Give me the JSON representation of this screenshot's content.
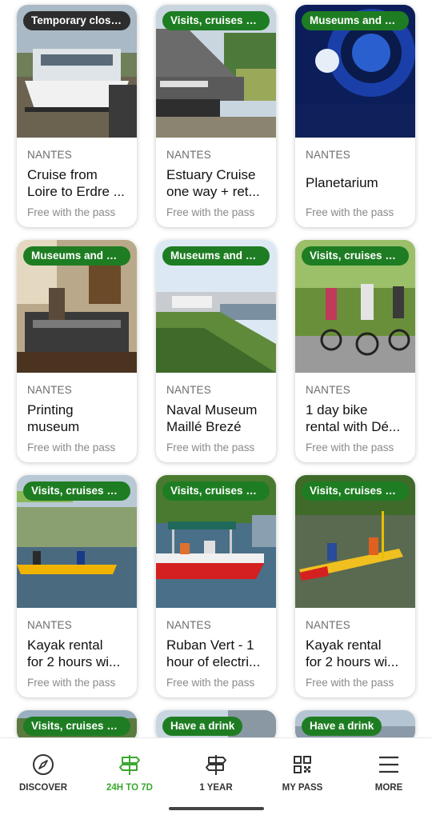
{
  "cards": [
    {
      "badge": "Temporary closure",
      "badge_style": "dark",
      "city": "NANTES",
      "title1": "Cruise from",
      "title2": "Loire to Erdre ...",
      "sub": "Free with the pass"
    },
    {
      "badge": "Visits, cruises and ...",
      "badge_style": "green",
      "city": "NANTES",
      "title1": "Estuary Cruise",
      "title2": "one way + ret...",
      "sub": "Free with the pass"
    },
    {
      "badge": "Museums and sites",
      "badge_style": "green",
      "city": "NANTES",
      "title1": "Planetarium",
      "title2": "",
      "sub": "Free with the pass"
    },
    {
      "badge": "Museums and sites",
      "badge_style": "green",
      "city": "NANTES",
      "title1": "Printing",
      "title2": "museum",
      "sub": "Free with the pass"
    },
    {
      "badge": "Museums and sites",
      "badge_style": "green",
      "city": "NANTES",
      "title1": "Naval Museum",
      "title2": "Maillé Brezé",
      "sub": "Free with the pass"
    },
    {
      "badge": "Visits, cruises and ...",
      "badge_style": "green",
      "city": "NANTES",
      "title1": "1 day bike",
      "title2": "rental with Dé...",
      "sub": "Free with the pass"
    },
    {
      "badge": "Visits, cruises and ...",
      "badge_style": "green",
      "city": "NANTES",
      "title1": "Kayak rental",
      "title2": "for 2 hours wi...",
      "sub": "Free with the pass"
    },
    {
      "badge": "Visits, cruises and ...",
      "badge_style": "green",
      "city": "NANTES",
      "title1": "Ruban Vert - 1",
      "title2": "hour of electri...",
      "sub": "Free with the pass"
    },
    {
      "badge": "Visits, cruises and ...",
      "badge_style": "green",
      "city": "NANTES",
      "title1": "Kayak rental",
      "title2": "for 2 hours wi...",
      "sub": "Free with the pass"
    }
  ],
  "partial_cards": [
    {
      "badge": "Visits, cruises and ...",
      "badge_style": "green"
    },
    {
      "badge": "Have a drink",
      "badge_style": "green"
    },
    {
      "badge": "Have a drink",
      "badge_style": "green"
    }
  ],
  "nav": {
    "discover": "DISCOVER",
    "h24to7d": "24H TO 7D",
    "year": "1 YEAR",
    "mypass": "MY PASS",
    "more": "MORE",
    "active": "24H TO 7D"
  },
  "colors": {
    "accent_green": "#1e7d22",
    "nav_active": "#3aa82f",
    "badge_dark": "#2d2d2d"
  }
}
